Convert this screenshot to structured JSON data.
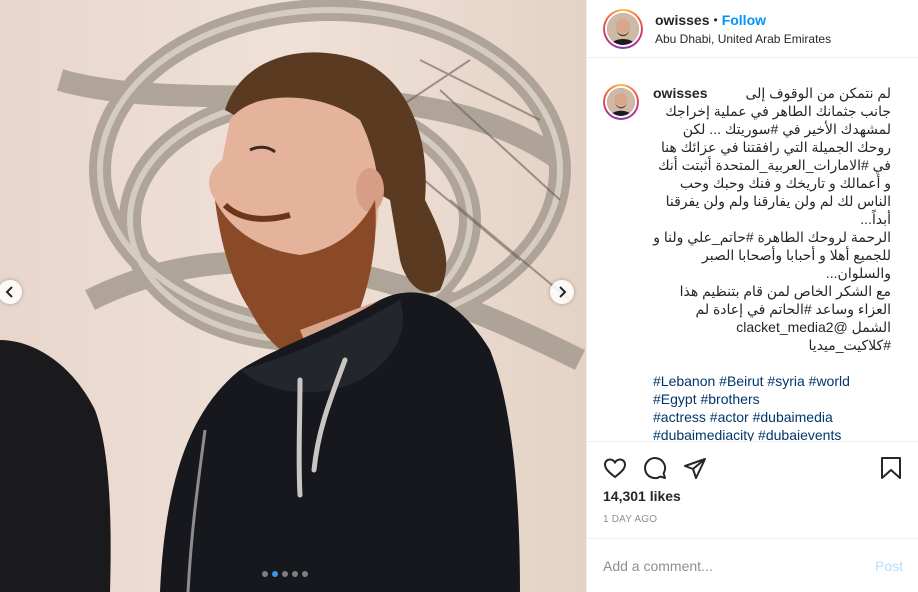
{
  "post": {
    "username": "owisses",
    "follow_label": "Follow",
    "separator": "•",
    "location": "Abu Dhabi, United Arab Emirates"
  },
  "caption": {
    "username": "owisses",
    "text": "لم نتمكن من الوقوف إلى جانب جثمانك الطاهر في عملية إخراجك لمشهدك الأخير في #سوريتك ... لكن روحك الجميلة التي رافقتنا في عزائك هنا في #الامارات_العربية_المتحدة أثبتت أنك و أعمالك و تاريخك و فنك وحبك وحب الناس لك لم ولن يفارقنا ولم ولن يفرقنا أبداً...\nالرحمة لروحك الطاهرة #حاتم_علي ولنا و للجميع أهلا و أحبابا وأصحابا الصبر والسلوان...\nمع الشكر الخاص لمن قام بتنظيم هذا العزاء وساعد #الحاتم في إعادة لم الشمل @clacket_media2 #كلاكيت_ميديا",
    "hashtags": "#Lebanon #Beirut #syria #world\n#Egypt #brothers\n#actress #actor #dubaimedia\n#dubaimediacity #dubaievents\n#uaemedia #uaeevents\n#abudhabievents #abudhabimagazine"
  },
  "engagement": {
    "likes": "14,301 likes",
    "date": "1 DAY AGO"
  },
  "comment": {
    "placeholder": "Add a comment...",
    "post_label": "Post"
  },
  "carousel": {
    "slide_count": 5,
    "active_index": 1
  },
  "icons": {
    "like": "heart-icon",
    "comment": "comment-bubble-icon",
    "share": "paper-plane-icon",
    "save": "bookmark-icon",
    "prev": "chevron-left-icon",
    "next": "chevron-right-icon"
  },
  "colors": {
    "accent": "#0095f6",
    "hashtag": "#00376b",
    "muted": "#8e8e8e",
    "active_dot": "#3897f0"
  }
}
